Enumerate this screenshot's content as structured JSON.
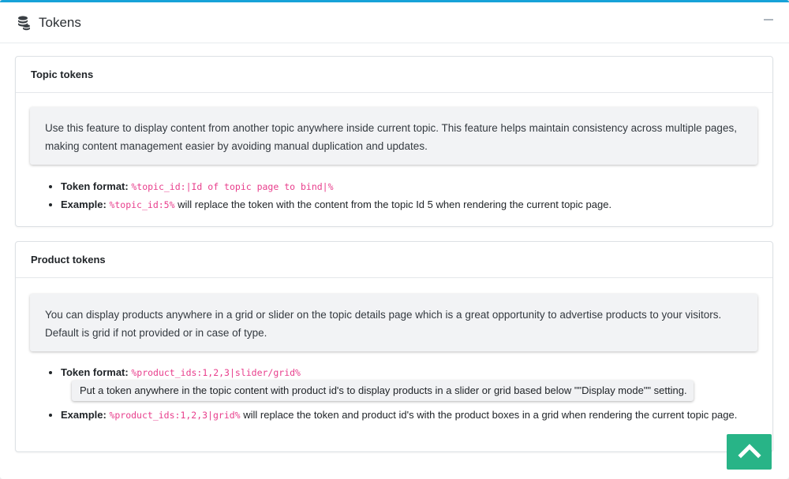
{
  "header": {
    "title": "Tokens",
    "icon": "coins-stack-icon",
    "collapse_icon": "minus-icon"
  },
  "topic_tokens": {
    "title": "Topic tokens",
    "description": "Use this feature to display content from another topic anywhere inside current topic. This feature helps maintain consistency across multiple pages, making content management easier by avoiding manual duplication and updates.",
    "format_label": "Token format:",
    "format_value": "%topic_id:|Id of topic page to bind|%",
    "example_label": "Example:",
    "example_code": "%topic_id:5%",
    "example_text": " will replace the token with the content from the topic Id 5 when rendering the current topic page."
  },
  "product_tokens": {
    "title": "Product tokens",
    "description": "You can display products anywhere in a grid or slider on the topic details page which is a great opportunity to advertise products to your visitors. Default is grid if not provided or in case of type.",
    "format_label": "Token format:",
    "format_value": "%product_ids:1,2,3|slider/grid%",
    "tooltip": "Put a token anywhere in the topic content with product id's to display products in a slider or grid based below \"\"Display mode\"\" setting.",
    "example_label": "Example:",
    "example_code": "%product_ids:1,2,3|grid%",
    "example_text": " will replace the token and product id's with the product boxes in a grid when rendering the current topic page."
  },
  "scroll_top": {
    "icon": "chevron-up-icon"
  },
  "colors": {
    "accent": "#17a2d8",
    "code": "#e83e8c",
    "scroll_button": "#28b487"
  }
}
